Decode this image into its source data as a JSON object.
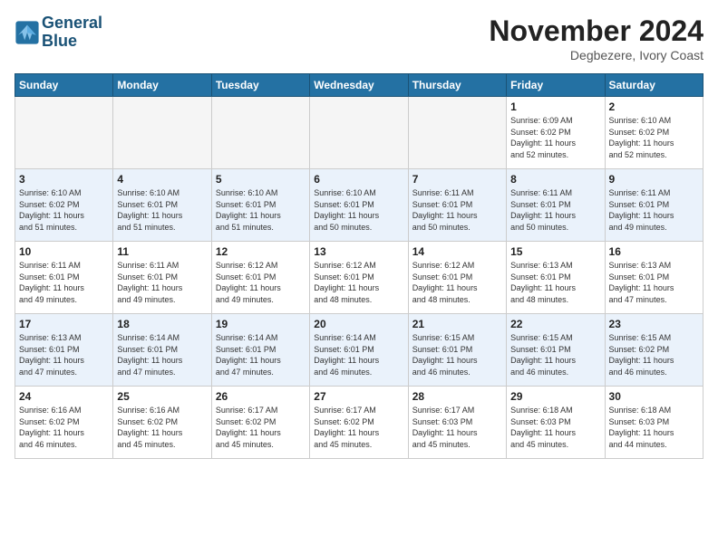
{
  "header": {
    "logo_line1": "General",
    "logo_line2": "Blue",
    "month_year": "November 2024",
    "location": "Degbezere, Ivory Coast"
  },
  "weekdays": [
    "Sunday",
    "Monday",
    "Tuesday",
    "Wednesday",
    "Thursday",
    "Friday",
    "Saturday"
  ],
  "weeks": [
    [
      {
        "day": "",
        "info": ""
      },
      {
        "day": "",
        "info": ""
      },
      {
        "day": "",
        "info": ""
      },
      {
        "day": "",
        "info": ""
      },
      {
        "day": "",
        "info": ""
      },
      {
        "day": "1",
        "info": "Sunrise: 6:09 AM\nSunset: 6:02 PM\nDaylight: 11 hours\nand 52 minutes."
      },
      {
        "day": "2",
        "info": "Sunrise: 6:10 AM\nSunset: 6:02 PM\nDaylight: 11 hours\nand 52 minutes."
      }
    ],
    [
      {
        "day": "3",
        "info": "Sunrise: 6:10 AM\nSunset: 6:02 PM\nDaylight: 11 hours\nand 51 minutes."
      },
      {
        "day": "4",
        "info": "Sunrise: 6:10 AM\nSunset: 6:01 PM\nDaylight: 11 hours\nand 51 minutes."
      },
      {
        "day": "5",
        "info": "Sunrise: 6:10 AM\nSunset: 6:01 PM\nDaylight: 11 hours\nand 51 minutes."
      },
      {
        "day": "6",
        "info": "Sunrise: 6:10 AM\nSunset: 6:01 PM\nDaylight: 11 hours\nand 50 minutes."
      },
      {
        "day": "7",
        "info": "Sunrise: 6:11 AM\nSunset: 6:01 PM\nDaylight: 11 hours\nand 50 minutes."
      },
      {
        "day": "8",
        "info": "Sunrise: 6:11 AM\nSunset: 6:01 PM\nDaylight: 11 hours\nand 50 minutes."
      },
      {
        "day": "9",
        "info": "Sunrise: 6:11 AM\nSunset: 6:01 PM\nDaylight: 11 hours\nand 49 minutes."
      }
    ],
    [
      {
        "day": "10",
        "info": "Sunrise: 6:11 AM\nSunset: 6:01 PM\nDaylight: 11 hours\nand 49 minutes."
      },
      {
        "day": "11",
        "info": "Sunrise: 6:11 AM\nSunset: 6:01 PM\nDaylight: 11 hours\nand 49 minutes."
      },
      {
        "day": "12",
        "info": "Sunrise: 6:12 AM\nSunset: 6:01 PM\nDaylight: 11 hours\nand 49 minutes."
      },
      {
        "day": "13",
        "info": "Sunrise: 6:12 AM\nSunset: 6:01 PM\nDaylight: 11 hours\nand 48 minutes."
      },
      {
        "day": "14",
        "info": "Sunrise: 6:12 AM\nSunset: 6:01 PM\nDaylight: 11 hours\nand 48 minutes."
      },
      {
        "day": "15",
        "info": "Sunrise: 6:13 AM\nSunset: 6:01 PM\nDaylight: 11 hours\nand 48 minutes."
      },
      {
        "day": "16",
        "info": "Sunrise: 6:13 AM\nSunset: 6:01 PM\nDaylight: 11 hours\nand 47 minutes."
      }
    ],
    [
      {
        "day": "17",
        "info": "Sunrise: 6:13 AM\nSunset: 6:01 PM\nDaylight: 11 hours\nand 47 minutes."
      },
      {
        "day": "18",
        "info": "Sunrise: 6:14 AM\nSunset: 6:01 PM\nDaylight: 11 hours\nand 47 minutes."
      },
      {
        "day": "19",
        "info": "Sunrise: 6:14 AM\nSunset: 6:01 PM\nDaylight: 11 hours\nand 47 minutes."
      },
      {
        "day": "20",
        "info": "Sunrise: 6:14 AM\nSunset: 6:01 PM\nDaylight: 11 hours\nand 46 minutes."
      },
      {
        "day": "21",
        "info": "Sunrise: 6:15 AM\nSunset: 6:01 PM\nDaylight: 11 hours\nand 46 minutes."
      },
      {
        "day": "22",
        "info": "Sunrise: 6:15 AM\nSunset: 6:01 PM\nDaylight: 11 hours\nand 46 minutes."
      },
      {
        "day": "23",
        "info": "Sunrise: 6:15 AM\nSunset: 6:02 PM\nDaylight: 11 hours\nand 46 minutes."
      }
    ],
    [
      {
        "day": "24",
        "info": "Sunrise: 6:16 AM\nSunset: 6:02 PM\nDaylight: 11 hours\nand 46 minutes."
      },
      {
        "day": "25",
        "info": "Sunrise: 6:16 AM\nSunset: 6:02 PM\nDaylight: 11 hours\nand 45 minutes."
      },
      {
        "day": "26",
        "info": "Sunrise: 6:17 AM\nSunset: 6:02 PM\nDaylight: 11 hours\nand 45 minutes."
      },
      {
        "day": "27",
        "info": "Sunrise: 6:17 AM\nSunset: 6:02 PM\nDaylight: 11 hours\nand 45 minutes."
      },
      {
        "day": "28",
        "info": "Sunrise: 6:17 AM\nSunset: 6:03 PM\nDaylight: 11 hours\nand 45 minutes."
      },
      {
        "day": "29",
        "info": "Sunrise: 6:18 AM\nSunset: 6:03 PM\nDaylight: 11 hours\nand 45 minutes."
      },
      {
        "day": "30",
        "info": "Sunrise: 6:18 AM\nSunset: 6:03 PM\nDaylight: 11 hours\nand 44 minutes."
      }
    ]
  ]
}
